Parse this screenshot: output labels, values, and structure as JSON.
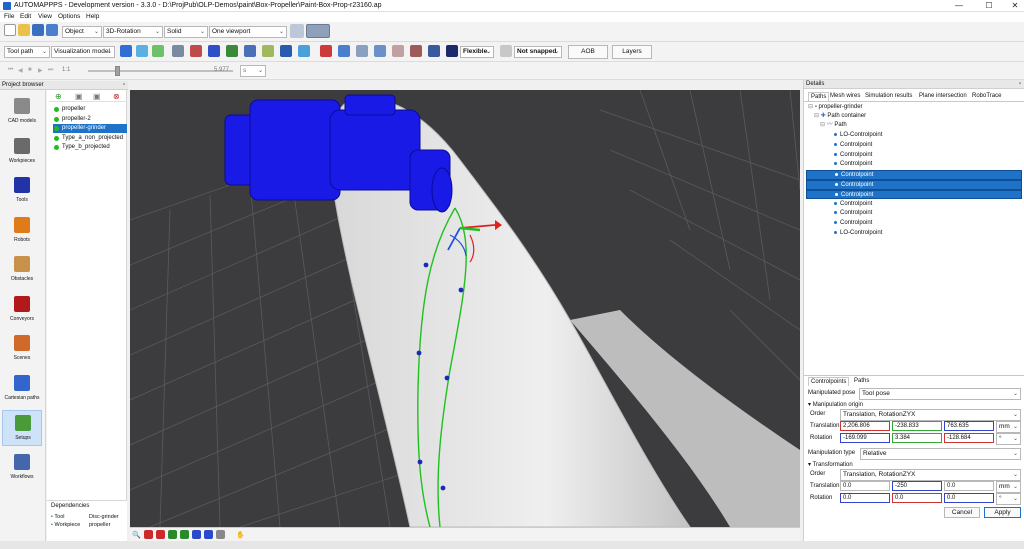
{
  "window": {
    "title": "AUTOMAPPPS - Development version - 3.3.0 - D:\\ProjPub\\OLP-Demos\\paint\\Box-Propeller\\Paint-Box-Prop-r23160.ap",
    "minimize": "—",
    "maximize": "☐",
    "close": "✕"
  },
  "menu": [
    "File",
    "Edit",
    "View",
    "Options",
    "Help"
  ],
  "toolbar1": {
    "object_combo": "Object",
    "rotation_combo": "3D-Rotation",
    "render_combo": "Solid",
    "viewport_combo": "One viewport"
  },
  "toolbar2": {
    "toolpath_combo": "Tool path",
    "visualization_combo": "Visualization model",
    "flexible_label": "Flexible",
    "snap_label": "Not snapped",
    "aob_button": "AOB",
    "layers_button": "Layers"
  },
  "toolbar3": {
    "step_value": "1:1",
    "slider_value": "5.977",
    "unit": "s",
    "slider_position": 0.2
  },
  "project_browser": {
    "title": "Project browser",
    "sidebar": [
      {
        "label": "CAD models",
        "icon": "cad-models-icon",
        "color": "#8a8a8a"
      },
      {
        "label": "Workpieces",
        "icon": "workpieces-icon",
        "color": "#6a6a6a"
      },
      {
        "label": "Tools",
        "icon": "tools-icon",
        "color": "#2233aa"
      },
      {
        "label": "Robots",
        "icon": "robots-icon",
        "color": "#e07b1a"
      },
      {
        "label": "Obstacles",
        "icon": "obstacles-icon",
        "color": "#c8924a"
      },
      {
        "label": "Conveyors",
        "icon": "conveyors-icon",
        "color": "#b01a1a"
      },
      {
        "label": "Scenes",
        "icon": "scenes-icon",
        "color": "#d06a2a"
      },
      {
        "label": "Cartesian paths",
        "icon": "cartesian-paths-icon",
        "color": "#3366cc"
      },
      {
        "label": "Setups",
        "icon": "setups-icon",
        "color": "#4a9a3a"
      },
      {
        "label": "Workflows",
        "icon": "workflows-icon",
        "color": "#4466aa"
      }
    ],
    "selected_sidebar_index": 8,
    "items": [
      {
        "label": "propeller",
        "selected": false
      },
      {
        "label": "propeller-2",
        "selected": false
      },
      {
        "label": "propeller-grinder",
        "selected": true
      },
      {
        "label": "Type_a_non_projected",
        "selected": false
      },
      {
        "label": "Type_b_projected",
        "selected": false
      }
    ],
    "dependencies_title": "Dependencies",
    "dependencies": [
      {
        "kind": "Tool",
        "value": "Disc-grinder"
      },
      {
        "kind": "Workpiece",
        "value": "propeller"
      }
    ]
  },
  "details": {
    "title": "Details",
    "tabs": [
      "Paths",
      "Mesh wires",
      "Simulation results",
      "Plane intersection",
      "RoboTrace"
    ],
    "selected_tab_index": 0,
    "tree_root": "propeller-grinder",
    "path_container": "Path container",
    "path": "Path",
    "points": [
      {
        "label": "LO-Controlpoint",
        "selected": false
      },
      {
        "label": "Controlpoint",
        "selected": false
      },
      {
        "label": "Controlpoint",
        "selected": false
      },
      {
        "label": "Controlpoint",
        "selected": false
      },
      {
        "label": "Controlpoint",
        "selected": true
      },
      {
        "label": "Controlpoint",
        "selected": true
      },
      {
        "label": "Controlpoint",
        "selected": true
      },
      {
        "label": "Controlpoint",
        "selected": false
      },
      {
        "label": "Controlpoint",
        "selected": false
      },
      {
        "label": "Controlpoint",
        "selected": false
      },
      {
        "label": "LO-Controlpoint",
        "selected": false
      }
    ],
    "lower_tabs": [
      "Controlpoints",
      "Paths"
    ],
    "manipulated_pose_label": "Manipulated pose",
    "manipulated_pose_value": "Tool pose",
    "manipulation_origin_label": "Manipulation origin",
    "order_label": "Order",
    "order_value": "Translation, RotationZYX",
    "translation_label": "Translation",
    "rotation_label": "Rotation",
    "origin_translation": [
      "2,206.806",
      "-238.833",
      "763.635"
    ],
    "origin_rotation": [
      "-169.099",
      "3.384",
      "-128.684"
    ],
    "unit_mm": "mm",
    "unit_deg": "°",
    "manipulation_type_label": "Manipulation type",
    "manipulation_type_value": "Relative",
    "transformation_label": "Transformation",
    "transform_order_value": "Translation, RotationZYX",
    "transform_translation": [
      "0.0",
      "-250",
      "0.0"
    ],
    "transform_rotation": [
      "0.0",
      "0.0",
      "0.0"
    ],
    "cancel_button": "Cancel",
    "apply_button": "Apply"
  }
}
